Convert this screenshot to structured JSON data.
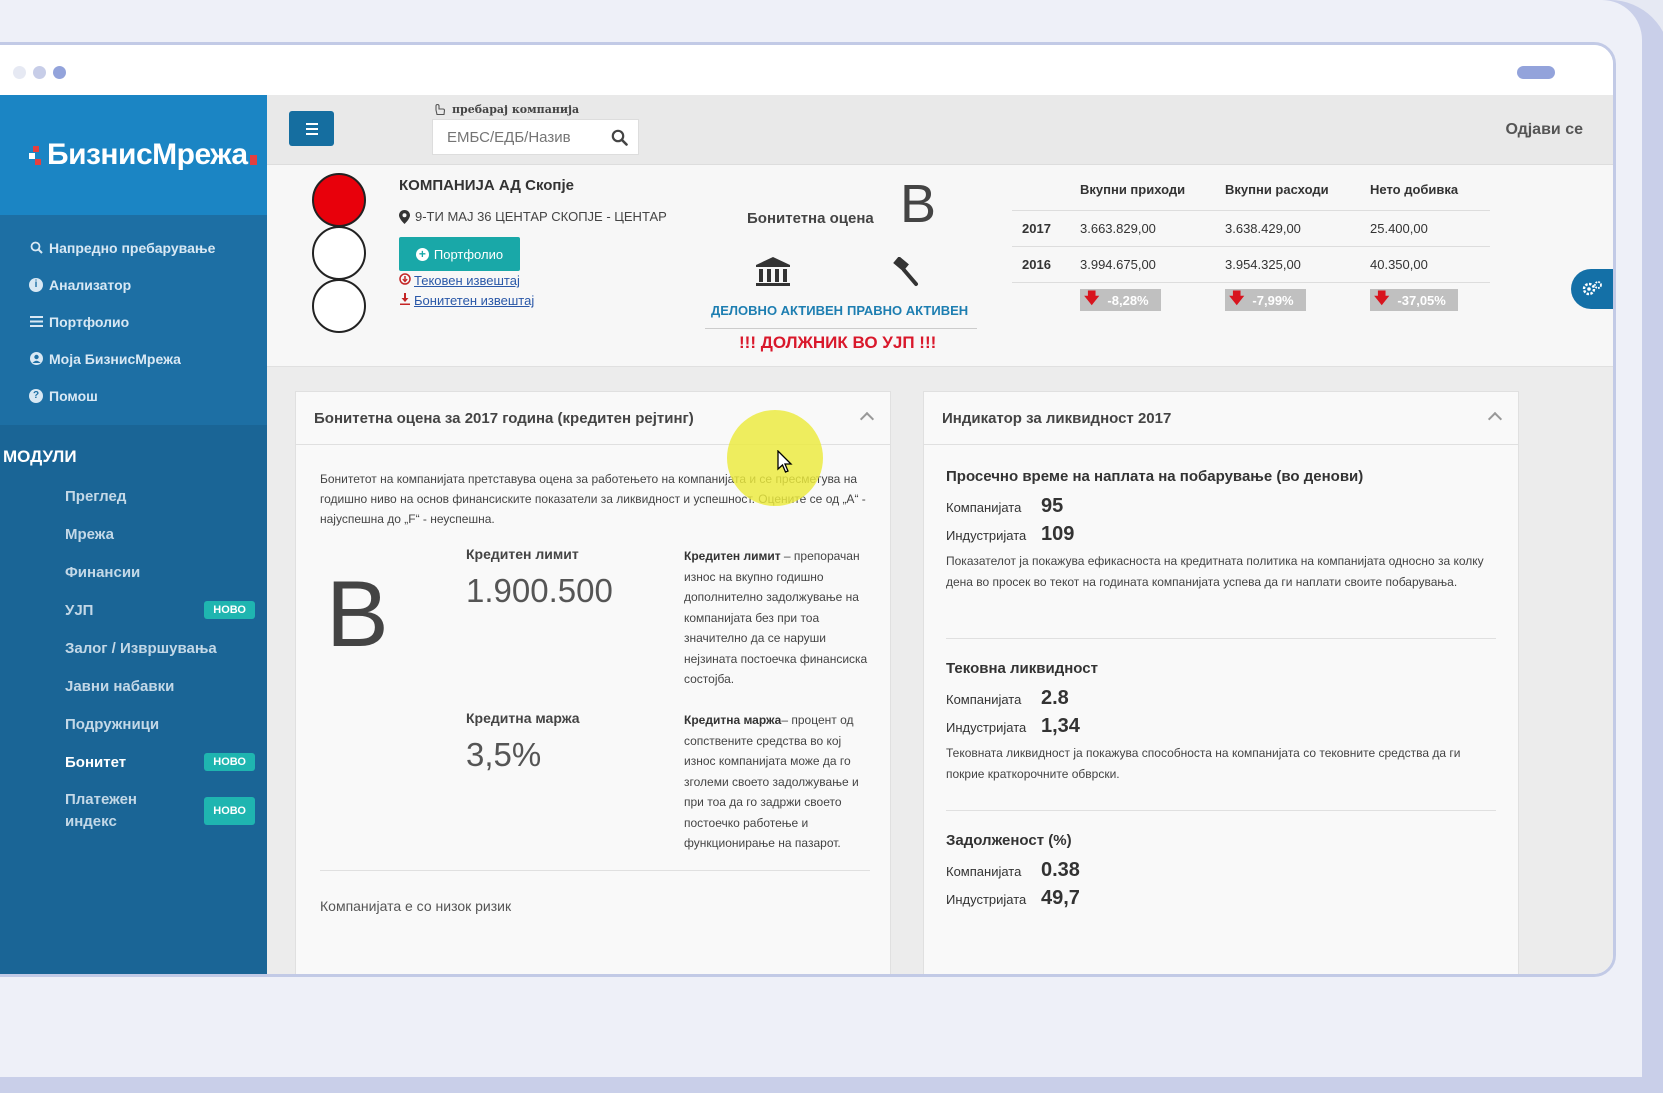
{
  "sidebar": {
    "logo": "БизнисМрежа",
    "nav": [
      {
        "label": "Напредно пребарување",
        "icon": "search-icon"
      },
      {
        "label": "Анализатор",
        "icon": "info-icon"
      },
      {
        "label": "Портфолио",
        "icon": "list-icon"
      },
      {
        "label": "Моја БизнисМрежа",
        "icon": "user-icon"
      },
      {
        "label": "Помош",
        "icon": "help-icon"
      }
    ],
    "modules_title": "МОДУЛИ",
    "modules": [
      {
        "label": "Преглед"
      },
      {
        "label": "Мрежа"
      },
      {
        "label": "Финансии"
      },
      {
        "label": "УЈП",
        "badge": "НОВО"
      },
      {
        "label": "Залог / Извршувања"
      },
      {
        "label": "Јавни набавки"
      },
      {
        "label": "Подружници"
      },
      {
        "label": "Бонитет",
        "badge": "НОВО",
        "active": true
      },
      {
        "label_line1": "Платежен",
        "label_line2": "индекс",
        "badge": "НОВО"
      }
    ]
  },
  "topbar": {
    "search_label": "пребарај компанија",
    "search_placeholder": "ЕМБС/ЕДБ/Назив",
    "logout": "Одјави се"
  },
  "company": {
    "name": "КОМПАНИЈА АД Скопје",
    "address": "9-ТИ МАЈ 36 ЦЕНТАР СКОПЈЕ - ЦЕНТАР",
    "portfolio_button": "Портфолио",
    "link_current": "Тековен извештај",
    "link_rating": "Бонитетен извештај",
    "rating_label": "Бонитетна оцена",
    "rating": "B",
    "status_business": "ДЕЛОВНО АКТИВЕН",
    "status_legal": "ПРАВНО АКТИВЕН",
    "debtor": "!!! ДОЛЖНИК ВО УЈП !!!",
    "traffic_light": "red"
  },
  "finances": {
    "headers": [
      "Вкупни приходи",
      "Вкупни расходи",
      "Нето добивка"
    ],
    "rows": [
      {
        "year": "2017",
        "values": [
          "3.663.829,00",
          "3.638.429,00",
          "25.400,00"
        ]
      },
      {
        "year": "2016",
        "values": [
          "3.994.675,00",
          "3.954.325,00",
          "40.350,00"
        ]
      }
    ],
    "changes": [
      "-8,28%",
      "-7,99%",
      "-37,05%"
    ]
  },
  "rating_panel": {
    "title": "Бонитетна оцена за 2017 година (кредитен рејтинг)",
    "description": "Бонитетот на компанијата претставува оцена за работењето на компанијата и се пресметува на годишно ниво на основ финансиските показатели за ликвидност и успешност. Оцените се од „А“ - најуспешна до „F“ - неуспешна.",
    "grade": "B",
    "credit_limit_label": "Кредитен лимит",
    "credit_limit_value": "1.900.500",
    "credit_limit_term": "Кредитен лимит",
    "credit_limit_desc": " – препорачан износ на вкупно годишно дополнително задолжување на компанијата без при тоа значително да се наруши нејзината постоечка финансиска состојба.",
    "credit_margin_label": "Кредитна маржа",
    "credit_margin_value": "3,5%",
    "credit_margin_term": "Кредитна маржа",
    "credit_margin_desc": "– процент од сопствените средства во кој износ компанијата може да го зголеми своето задолжување и при тоа да го задржи своето постоечко работење и функционирање на пазарот.",
    "risk": "Компанијата е со низок ризик"
  },
  "liquidity_panel": {
    "title": "Индикатор за ликвидност 2017",
    "company_label": "Компанијата",
    "industry_label": "Индустријата",
    "sections": [
      {
        "title": "Просечно време на наплата на побарување (во денови)",
        "company": "95",
        "industry": "109",
        "desc": "Показателот ја покажува ефикасноста на кредитната политика на компанијата односно за колку дена во просек во текот на годината компанијата успева да ги наплати своите побарувања."
      },
      {
        "title": "Тековна ликвидност",
        "company": "2.8",
        "industry": "1,34",
        "desc": "Тековната ликвидност ја покажува способноста на компанијата со тековните средства да ги покрие краткорочните обврски."
      },
      {
        "title": "Задолженост (%)",
        "company": "0.38",
        "industry": "49,7"
      }
    ]
  },
  "colors": {
    "sidebar": "#1c72a6",
    "accent": "#19a8a8",
    "debtor": "#d9182b",
    "status": "#1d7eb1"
  }
}
